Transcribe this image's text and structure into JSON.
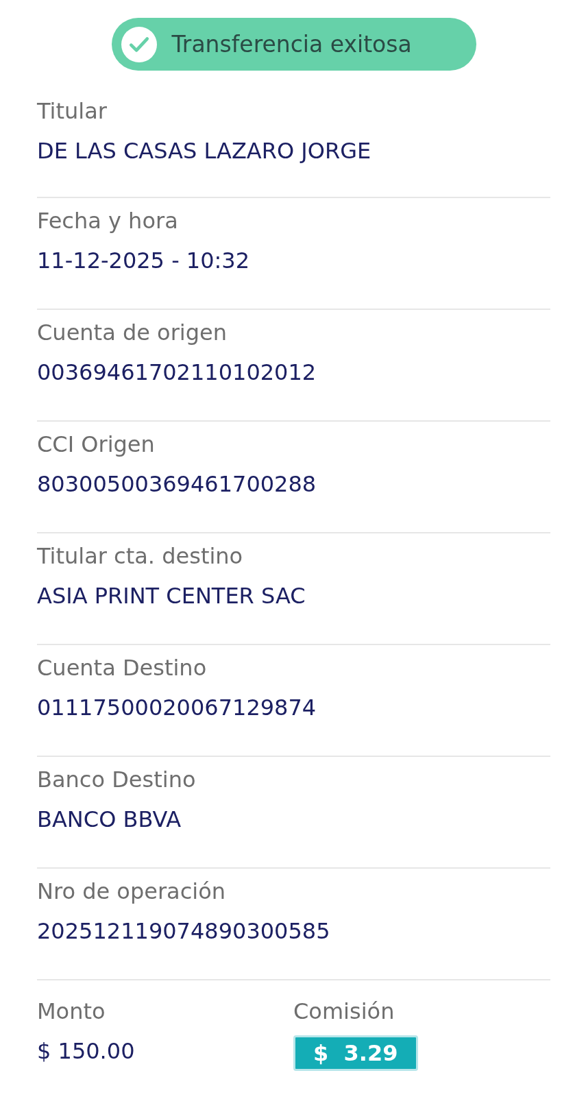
{
  "status": {
    "label": "Transferencia exitosa"
  },
  "fields": [
    {
      "label": "Titular",
      "value": "DE LAS CASAS LAZARO JORGE"
    },
    {
      "label": "Fecha y hora",
      "value": "11-12-2025 - 10:32"
    },
    {
      "label": "Cuenta de origen",
      "value": "00369461702110102012"
    },
    {
      "label": "CCI Origen",
      "value": "80300500369461700288"
    },
    {
      "label": "Titular cta. destino",
      "value": "ASIA PRINT CENTER SAC"
    },
    {
      "label": "Cuenta Destino",
      "value": "01117500020067129874"
    },
    {
      "label": "Banco Destino",
      "value": "BANCO BBVA"
    },
    {
      "label": "Nro de operación",
      "value": "202512119074890300585"
    }
  ],
  "amount": {
    "label": "Monto",
    "value": "$ 150.00"
  },
  "fee": {
    "label": "Comisión",
    "value": "$  3.29"
  }
}
